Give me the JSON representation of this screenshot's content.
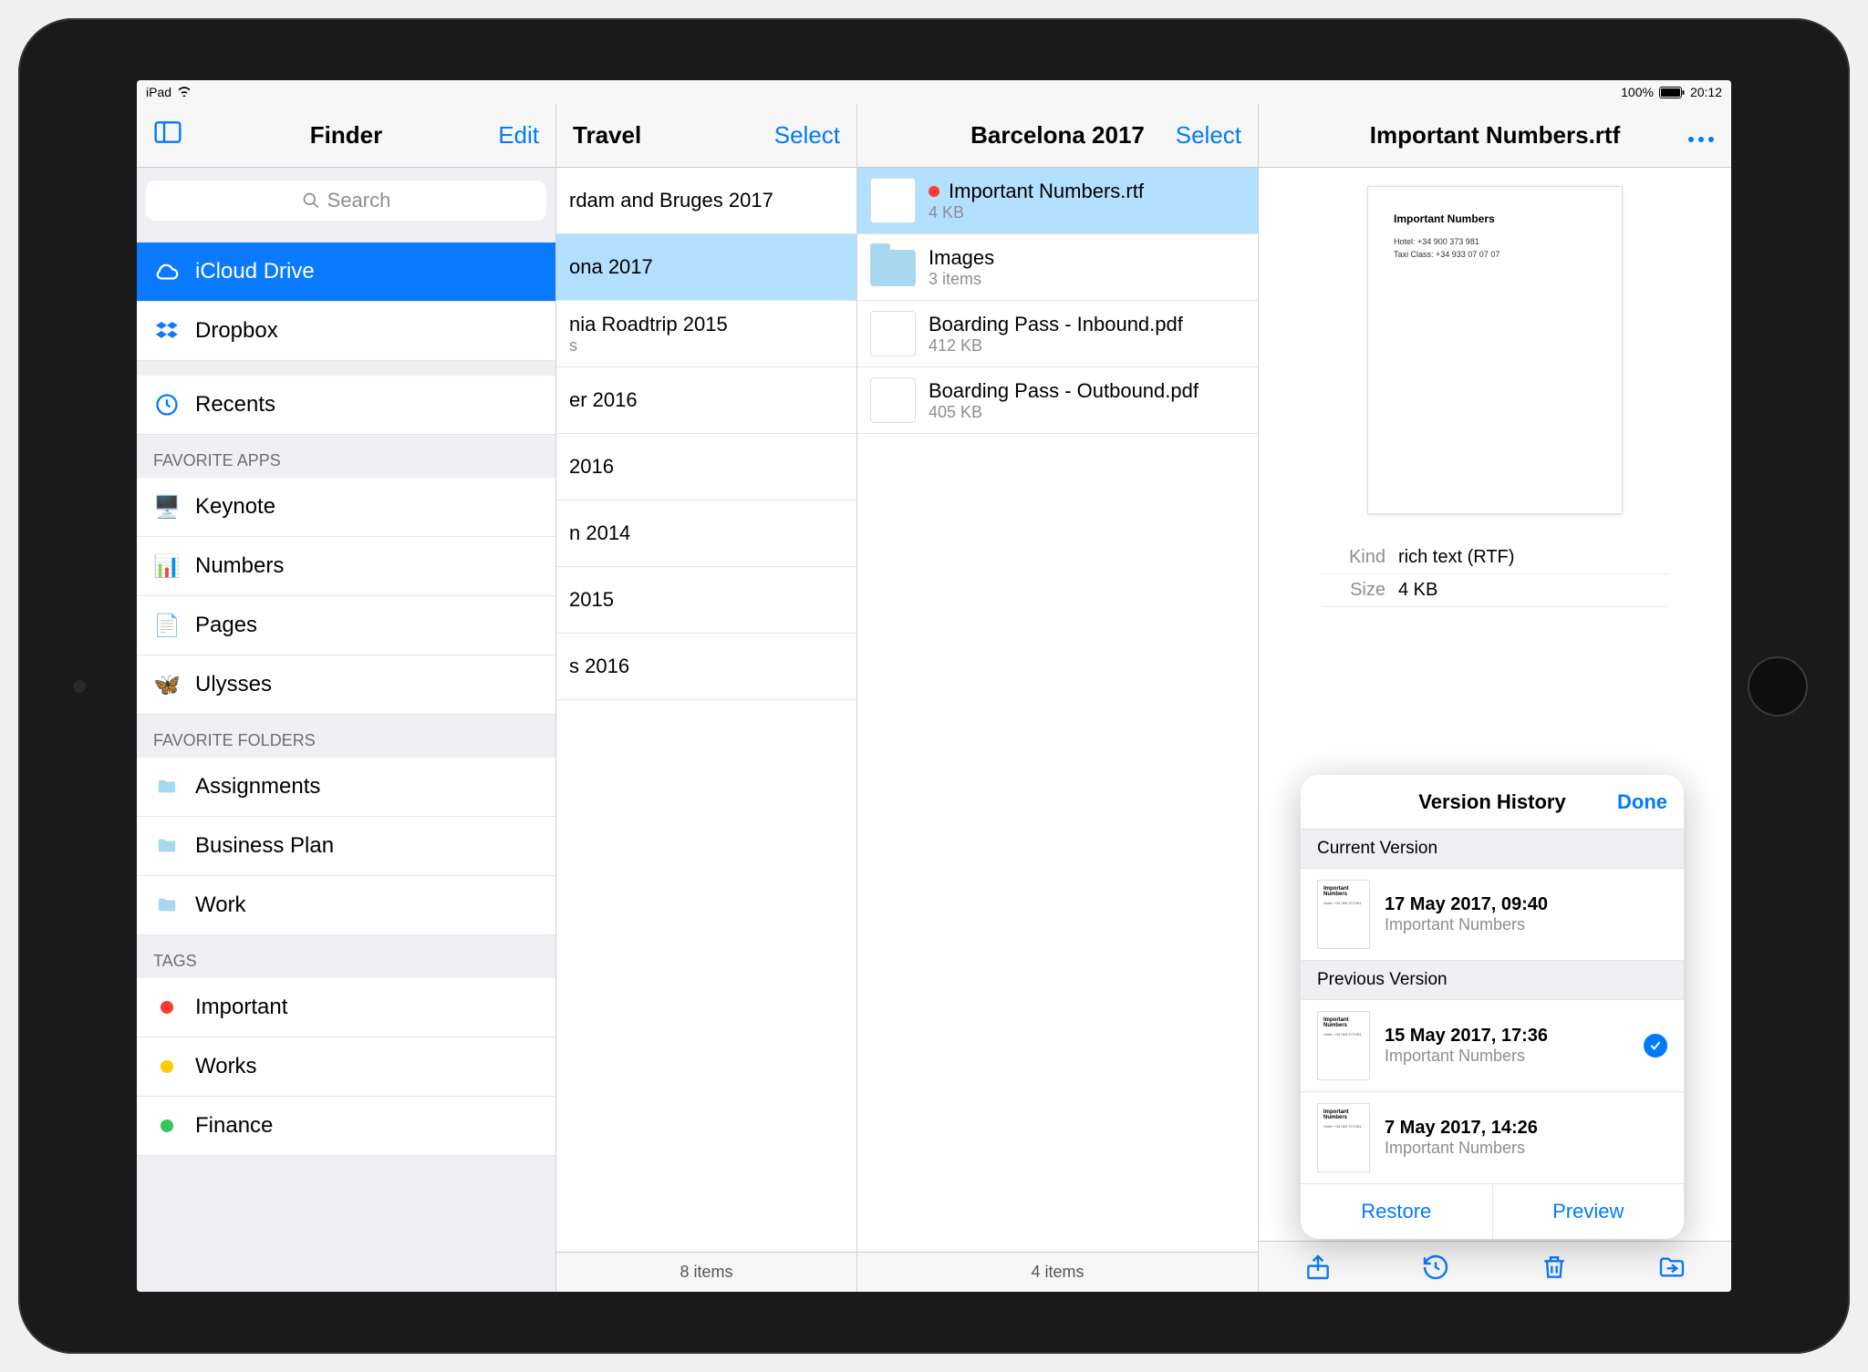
{
  "status_bar": {
    "carrier": "iPad",
    "battery_pct": "100%",
    "time": "20:12"
  },
  "sidebar": {
    "title": "Finder",
    "edit_label": "Edit",
    "search_placeholder": "Search",
    "locations": [
      {
        "label": "iCloud Drive",
        "icon": "cloud"
      },
      {
        "label": "Dropbox",
        "icon": "dropbox"
      }
    ],
    "recents_label": "Recents",
    "favorite_apps_header": "FAVORITE APPS",
    "favorite_apps": [
      {
        "label": "Keynote"
      },
      {
        "label": "Numbers"
      },
      {
        "label": "Pages"
      },
      {
        "label": "Ulysses"
      }
    ],
    "favorite_folders_header": "FAVORITE FOLDERS",
    "favorite_folders": [
      {
        "label": "Assignments"
      },
      {
        "label": "Business Plan"
      },
      {
        "label": "Work"
      }
    ],
    "tags_header": "TAGS",
    "tags": [
      {
        "label": "Important",
        "color": "#ff3b30"
      },
      {
        "label": "Works",
        "color": "#ffcc00"
      },
      {
        "label": "Finance",
        "color": "#34c759"
      }
    ]
  },
  "col_travel": {
    "title": "Travel",
    "select_label": "Select",
    "footer": "8 items",
    "items": [
      {
        "name": "rdam and Bruges 2017",
        "sub": ""
      },
      {
        "name": "ona 2017",
        "sub": ""
      },
      {
        "name": "nia Roadtrip 2015",
        "sub": "s"
      },
      {
        "name": "er 2016",
        "sub": ""
      },
      {
        "name": "2016",
        "sub": ""
      },
      {
        "name": "n 2014",
        "sub": ""
      },
      {
        "name": "2015",
        "sub": ""
      },
      {
        "name": "s 2016",
        "sub": ""
      }
    ]
  },
  "col_barcelona": {
    "title": "Barcelona 2017",
    "select_label": "Select",
    "footer": "4 items",
    "items": [
      {
        "name": "Important Numbers.rtf",
        "sub": "4 KB",
        "tag": "#ff3b30",
        "kind": "doc"
      },
      {
        "name": "Images",
        "sub": "3 items",
        "kind": "folder"
      },
      {
        "name": "Boarding Pass - Inbound.pdf",
        "sub": "412 KB",
        "kind": "doc"
      },
      {
        "name": "Boarding Pass - Outbound.pdf",
        "sub": "405 KB",
        "kind": "doc"
      }
    ]
  },
  "detail": {
    "title": "Important Numbers.rtf",
    "preview_title": "Important Numbers",
    "preview_lines": [
      "Hotel: +34 900 373 981",
      "Taxi Class: +34 933 07 07 07"
    ],
    "info": [
      {
        "k": "Kind",
        "v": "rich text (RTF)"
      },
      {
        "k": "Size",
        "v": "4 KB"
      }
    ]
  },
  "version_popover": {
    "title": "Version History",
    "done_label": "Done",
    "current_header": "Current Version",
    "previous_header": "Previous Version",
    "current": {
      "datetime": "17 May 2017, 09:40",
      "filename": "Important Numbers"
    },
    "previous": [
      {
        "datetime": "15 May 2017, 17:36",
        "filename": "Important Numbers",
        "selected": true
      },
      {
        "datetime": "7 May 2017, 14:26",
        "filename": "Important Numbers",
        "selected": false
      }
    ],
    "restore_label": "Restore",
    "preview_label": "Preview"
  }
}
